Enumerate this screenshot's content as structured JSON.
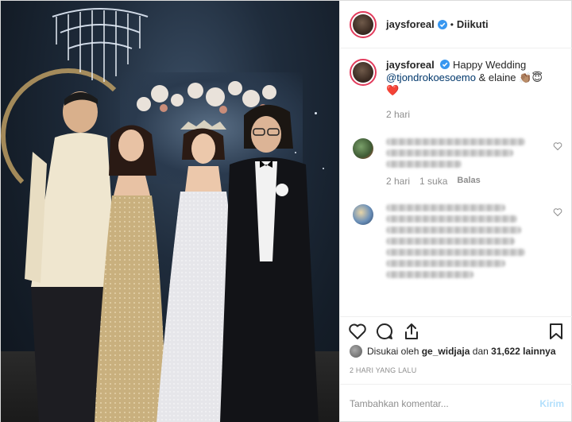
{
  "post": {
    "username": "jaysforeal",
    "follow_separator": "•",
    "follow_label": "Diikuti",
    "caption_text": "Happy Wedding",
    "caption_mention": "@tjondrokoesoemo",
    "caption_rest": "& elaine 👏🏽😇",
    "caption_heart": "❤️",
    "caption_time": "2 hari"
  },
  "comments": [
    {
      "time": "2 hari",
      "likes": "1 suka",
      "reply": "Balas",
      "blur_lines": 3
    },
    {
      "blur_lines": 7
    }
  ],
  "likes": {
    "prefix": "Disukai oleh",
    "user": "ge_widjaja",
    "connector": "dan",
    "count": "31,622 lainnya"
  },
  "date": "2 HARI YANG LALU",
  "add_comment": {
    "placeholder": "Tambahkan komentar...",
    "post_label": "Kirim"
  },
  "icons": [
    "heart-icon",
    "comment-icon",
    "share-icon",
    "bookmark-icon",
    "verified-icon"
  ],
  "colors": {
    "accent": "#0095f6",
    "verified": "#3897f0",
    "story_ring": "#e23b5c",
    "post_disabled": "#b2dffc"
  }
}
